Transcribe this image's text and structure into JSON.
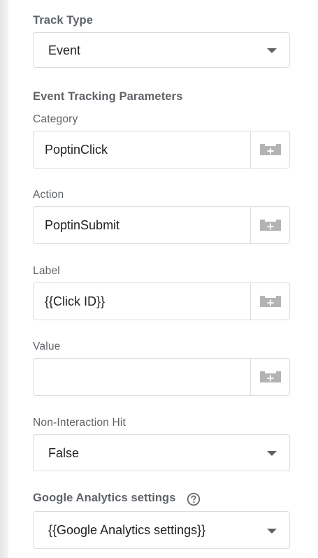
{
  "track_type": {
    "label": "Track Type",
    "value": "Event"
  },
  "event_tracking": {
    "title": "Event Tracking Parameters",
    "category": {
      "label": "Category",
      "value": "PoptinClick"
    },
    "action": {
      "label": "Action",
      "value": "PoptinSubmit"
    },
    "label_field": {
      "label": "Label",
      "value": "{{Click ID}}"
    },
    "value_field": {
      "label": "Value",
      "value": ""
    }
  },
  "non_interaction": {
    "label": "Non-Interaction Hit",
    "value": "False"
  },
  "ga_settings": {
    "label": "Google Analytics settings",
    "value": "{{Google Analytics settings}}"
  },
  "icons": {
    "variable": "add-variable-icon",
    "dropdown": "caret-down-icon",
    "help": "help-circle-icon"
  },
  "colors": {
    "label": "#5f6368",
    "text": "#202124",
    "border": "#dadce0",
    "icon": "#b3b3b3"
  }
}
